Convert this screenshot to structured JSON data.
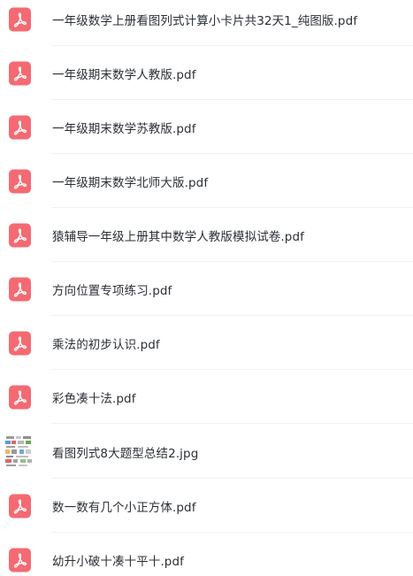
{
  "files": [
    {
      "name": "一年级数学上册看图列式计算小卡片共32天1_纯图版.pdf",
      "icon": "pdf-icon"
    },
    {
      "name": "一年级期末数学人教版.pdf",
      "icon": "pdf-icon"
    },
    {
      "name": "一年级期末数学苏教版.pdf",
      "icon": "pdf-icon"
    },
    {
      "name": "一年级期末数学北师大版.pdf",
      "icon": "pdf-icon"
    },
    {
      "name": "猿辅导一年级上册其中数学人教版模拟试卷.pdf",
      "icon": "pdf-icon"
    },
    {
      "name": "方向位置专项练习.pdf",
      "icon": "pdf-icon"
    },
    {
      "name": "乘法的初步认识.pdf",
      "icon": "pdf-icon"
    },
    {
      "name": "彩色凑十法.pdf",
      "icon": "pdf-icon"
    },
    {
      "name": "看图列式8大题型总结2.jpg",
      "icon": "image-thumbnail"
    },
    {
      "name": "数一数有几个小正方体.pdf",
      "icon": "pdf-icon"
    },
    {
      "name": "幼升小破十凑十平十.pdf",
      "icon": "pdf-icon"
    }
  ],
  "colors": {
    "pdf_icon": "#f46a72",
    "text": "#2b2f36",
    "divider": "#f1f1f3"
  }
}
